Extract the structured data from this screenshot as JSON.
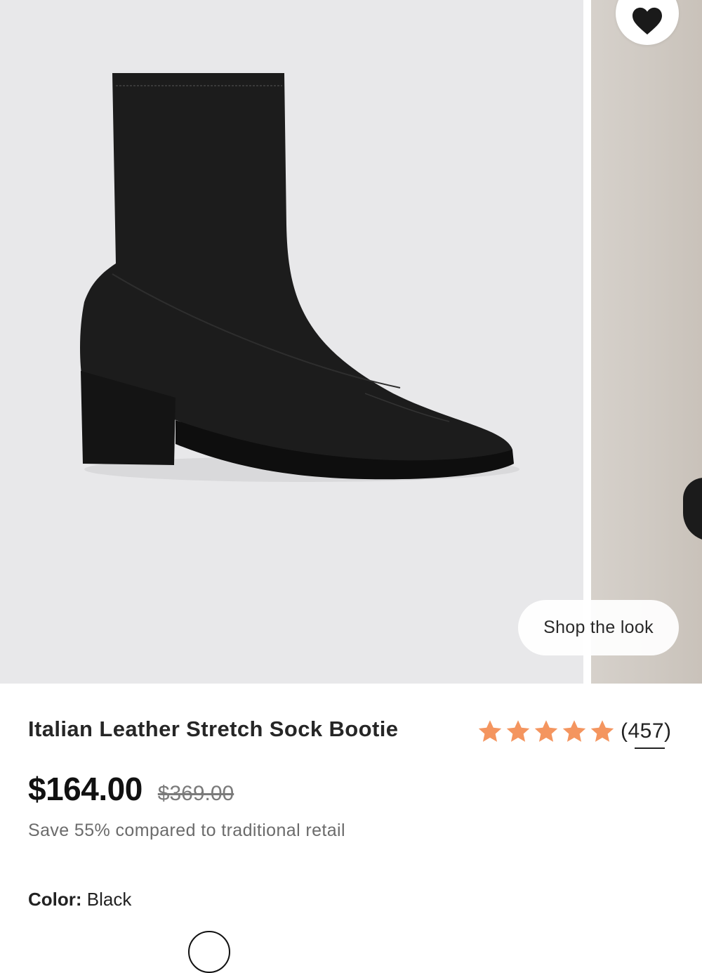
{
  "gallery": {
    "main_image_alt": "Italian Leather Stretch Sock Bootie in Black",
    "shop_the_look_label": "Shop the look",
    "favorite_icon": "heart-icon"
  },
  "product": {
    "title": "Italian Leather Stretch Sock Bootie",
    "rating": 5,
    "rating_max": 5,
    "review_count": "(457)",
    "price": "$164.00",
    "original_price": "$369.00",
    "savings_text": "Save 55% compared to traditional retail",
    "color_label": "Color:",
    "color_value": "Black"
  },
  "colors": {
    "star": "#f4955f",
    "boot": "#1c1c1c",
    "image_bg": "#e8e8ea"
  }
}
